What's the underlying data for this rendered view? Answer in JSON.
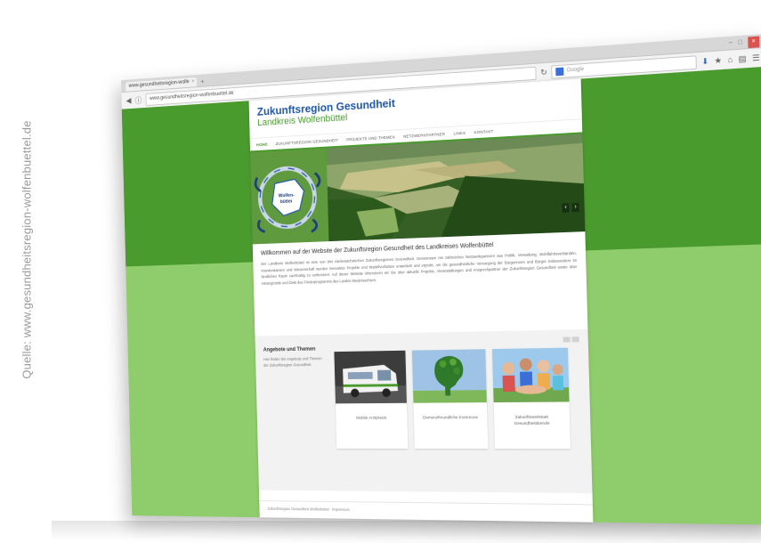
{
  "source_credit": "Quelle: www.gesundheitsregion-wolfenbuettel.de",
  "browser": {
    "tab_title": "www.gesundheitsregion-wolfe",
    "tab_close": "×",
    "new_tab": "+",
    "url": "www.gesundheitsregion-wolfenbuettel.de",
    "search_placeholder": "Google",
    "window_buttons": {
      "minimize": "−",
      "maximize": "□",
      "close": "×"
    }
  },
  "site": {
    "title": "Zukunftsregion Gesundheit",
    "subtitle": "Landkreis Wolfenbüttel",
    "nav": [
      {
        "label": "HOME"
      },
      {
        "label": "ZUKUNFTSREGION GESUNDHEIT"
      },
      {
        "label": "PROJEKTE UND THEMEN"
      },
      {
        "label": "NETZWERKPARTNER"
      },
      {
        "label": "LINKS"
      },
      {
        "label": "KONTAKT"
      }
    ],
    "hero": {
      "map_label_line1": "Wolfen-",
      "map_label_line2": "büttel",
      "prev": "‹",
      "next": "›"
    },
    "welcome": {
      "heading": "Willkommen auf der Website der Zukunftsregion Gesundheit des Landkreises Wolfenbüttel",
      "body": "Der Landkreis Wolfenbüttel ist eine von drei niedersächsischen Zukunftsregionen Gesundheit. Gemeinsam mit zahlreichen Netzwerkpartnern aus Politik, Verwaltung, Wohlfahrtsverbänden, Krankenkassen und Wissenschaft werden innovative Projekte und Modellvorhaben entwickelt und erprobt, um die gesundheitliche Versorgung der Bürgerinnen und Bürger insbesondere im ländlichen Raum nachhaltig zu verbessern. Auf dieser Website informieren wir Sie über aktuelle Projekte, Veranstaltungen und Ansprechpartner der Zukunftsregion Gesundheit sowie über Hintergründe und Ziele des Förderprogramms des Landes Niedersachsen."
    },
    "offers": {
      "title": "Angebote und Themen",
      "text": "Hier finden Sie Angebote und Themen der Zukunftsregion Gesundheit.",
      "cards": [
        {
          "caption": "Mobile Arztpraxis"
        },
        {
          "caption": "Demenzfreundliche Kommune"
        },
        {
          "caption": "Zukunftswerkstatt Gesundheitsberufe"
        }
      ]
    },
    "footer": "Zukunftsregion Gesundheit Wolfenbüttel · Impressum"
  }
}
